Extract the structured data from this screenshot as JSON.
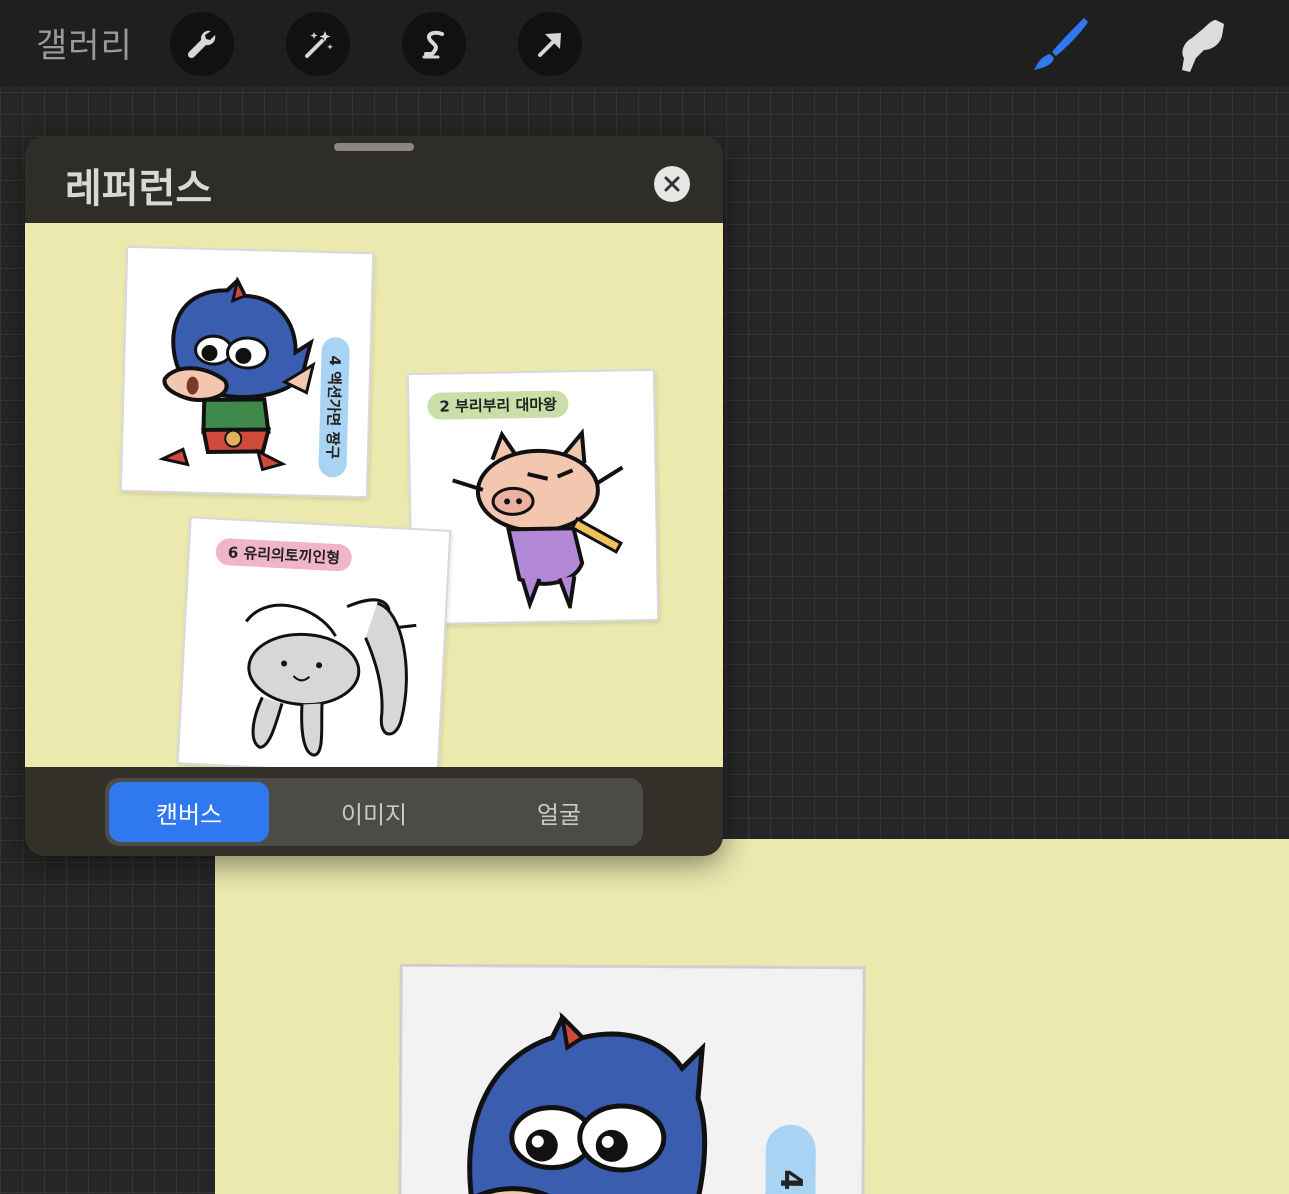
{
  "topbar": {
    "gallery_label": "갤러리",
    "tools": [
      {
        "icon": "wrench-icon"
      },
      {
        "icon": "magic-wand-icon"
      },
      {
        "icon": "selection-s-icon"
      },
      {
        "icon": "transform-arrow-icon"
      }
    ],
    "right_tools": [
      {
        "icon": "brush-icon",
        "color": "#2f78f0"
      },
      {
        "icon": "smudge-icon",
        "color": "#e0e0e0"
      }
    ]
  },
  "reference_panel": {
    "title": "레퍼런스",
    "close_icon": "close-icon",
    "image": {
      "cards": [
        {
          "label": "4 액션가면 짱구"
        },
        {
          "label": "2 부리부리 대마왕"
        },
        {
          "label": "6 유리의토끼인형"
        }
      ]
    },
    "tabs": [
      {
        "label": "캔버스",
        "active": true
      },
      {
        "label": "이미지",
        "active": false
      },
      {
        "label": "얼굴",
        "active": false
      }
    ]
  },
  "canvas": {
    "card_label": "4"
  },
  "colors": {
    "accent": "#2f78f0",
    "reference_bg": "#ece9ae",
    "panel_bg": "#33302a"
  }
}
